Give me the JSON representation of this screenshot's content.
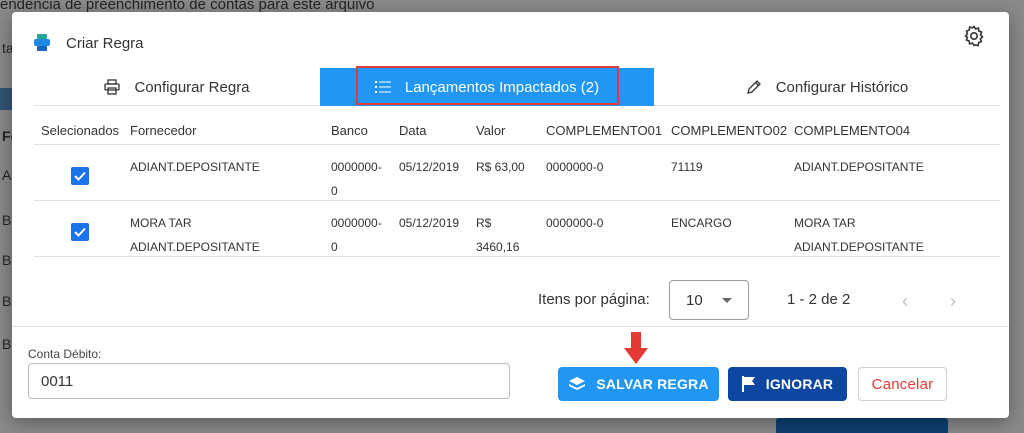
{
  "background": {
    "header_text": "endência de preenchimento de contas para este arquivo",
    "letters": [
      "ta",
      "Fo",
      "A",
      "B",
      "B",
      "B",
      "B"
    ]
  },
  "dialog": {
    "title": "Criar Regra",
    "icons": {
      "title": "printer-stack-icon",
      "settings": "gear-icon"
    }
  },
  "tabs": [
    {
      "label": "Configurar Regra",
      "icon": "printer-icon",
      "active": false
    },
    {
      "label": "Lançamentos Impactados (2)",
      "icon": "list-icon",
      "active": true
    },
    {
      "label": "Configurar Histórico",
      "icon": "pencil-icon",
      "active": false
    }
  ],
  "table": {
    "headers": [
      "Selecionados",
      "Fornecedor",
      "Banco",
      "Data",
      "Valor",
      "COMPLEMENTO01",
      "COMPLEMENTO02",
      "COMPLEMENTO04"
    ],
    "rows": [
      {
        "selected": true,
        "fornecedor": [
          "ADIANT.DEPOSITANTE"
        ],
        "banco": [
          "0000000-",
          "0"
        ],
        "data": "05/12/2019",
        "valor": [
          "R$ 63,00"
        ],
        "comp01": "0000000-0",
        "comp02": "71119",
        "comp04": [
          "ADIANT.DEPOSITANTE"
        ]
      },
      {
        "selected": true,
        "fornecedor": [
          "MORA TAR",
          "ADIANT.DEPOSITANTE"
        ],
        "banco": [
          "0000000-",
          "0"
        ],
        "data": "05/12/2019",
        "valor": [
          "R$",
          "3460,16"
        ],
        "comp01": "0000000-0",
        "comp02": "ENCARGO",
        "comp04": [
          "MORA TAR",
          "ADIANT.DEPOSITANTE"
        ]
      }
    ]
  },
  "pager": {
    "label": "Itens por página:",
    "page_size": "10",
    "range": "1 - 2 de 2",
    "prev": "‹",
    "next": "›"
  },
  "footer": {
    "field_label": "Conta Débito:",
    "field_value": "0011",
    "save_label": "SALVAR REGRA",
    "ignore_label": "IGNORAR",
    "cancel_label": "Cancelar"
  },
  "colors": {
    "primary": "#2196f3",
    "dark_primary": "#0d47a1",
    "danger": "#e53935",
    "highlight_box": "#e53935"
  }
}
